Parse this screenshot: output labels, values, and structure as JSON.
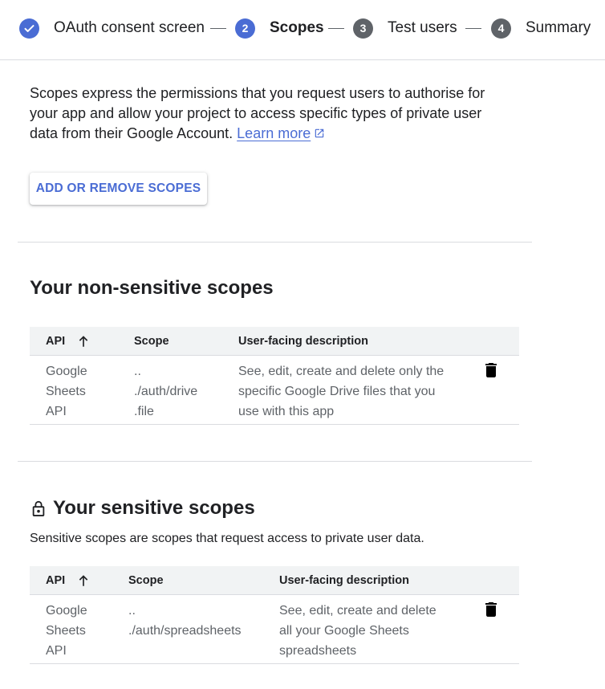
{
  "stepper": {
    "steps": [
      {
        "label": "OAuth consent screen",
        "number": "",
        "state": "done"
      },
      {
        "label": "Scopes",
        "number": "2",
        "state": "active"
      },
      {
        "label": "Test users",
        "number": "3",
        "state": "pending"
      },
      {
        "label": "Summary",
        "number": "4",
        "state": "pending"
      }
    ]
  },
  "intro": {
    "text": "Scopes express the permissions that you request users to authorise for your app and allow your project to access specific types of private user data from their Google Account.",
    "learn_more": "Learn more"
  },
  "add_scopes_button": "ADD OR REMOVE SCOPES",
  "non_sensitive": {
    "title": "Your non-sensitive scopes",
    "columns": [
      "API",
      "Scope",
      "User-facing description"
    ],
    "rows": [
      {
        "api": [
          "Google",
          "Sheets",
          "API"
        ],
        "scope": [
          "..",
          "./auth/drive",
          ".file"
        ],
        "description": [
          "See, edit, create and delete only the",
          "specific Google Drive files that you",
          "use with this app"
        ]
      }
    ]
  },
  "sensitive": {
    "title": "Your sensitive scopes",
    "description": "Sensitive scopes are scopes that request access to private user data.",
    "columns": [
      "API",
      "Scope",
      "User-facing description"
    ],
    "rows": [
      {
        "api": [
          "Google",
          "Sheets",
          "API"
        ],
        "scope": [
          "..",
          "./auth/spreadsheets"
        ],
        "description": [
          "See, edit, create and delete",
          "all your Google Sheets",
          "spreadsheets"
        ]
      }
    ]
  },
  "colors": {
    "accent": "#4a6cd4",
    "step_done": "#4a6cd4",
    "step_pending": "#5f6368",
    "header_bg": "#f1f3f4",
    "divider": "#dadce0"
  },
  "icons": [
    "check-icon",
    "external-link-icon",
    "arrow-up-icon",
    "trash-icon",
    "lock-icon"
  ]
}
